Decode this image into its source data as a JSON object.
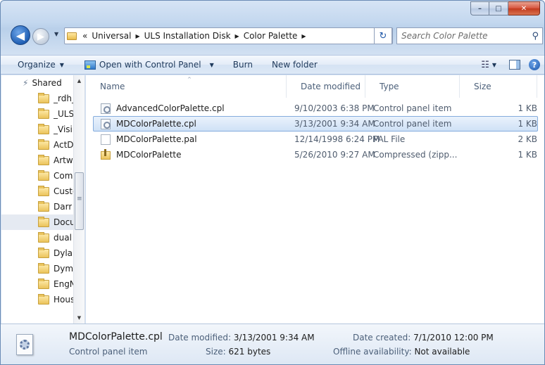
{
  "window": {
    "caption_buttons": {
      "minimize": "–",
      "maximize": "□",
      "close": "✕"
    }
  },
  "nav": {
    "back_glyph": "◀",
    "forward_glyph": "▶",
    "history_glyph": "▼"
  },
  "address": {
    "overflow": "«",
    "crumbs": [
      "Universal",
      "ULS Installation Disk",
      "Color Palette"
    ],
    "separator": "▶",
    "dropdown_glyph": "▼",
    "refresh_glyph": "↻"
  },
  "search": {
    "placeholder": "Search Color Palette",
    "icon": "search-icon"
  },
  "toolbar": {
    "organize": "Organize",
    "open_with": "Open with Control Panel",
    "burn": "Burn",
    "new_folder": "New folder",
    "arrow": "▼",
    "views_glyph": "☷",
    "help_glyph": "?"
  },
  "nav_pane": {
    "items": [
      "Shared",
      "_rdh_",
      "_ULS",
      "_Visi",
      "ActD",
      "Artw",
      "Com",
      "Custo",
      "Darr",
      "Docu",
      "dual",
      "Dyla",
      "Dym",
      "EngN",
      "Hous"
    ],
    "scroll_up": "▲",
    "scroll_down": "▼"
  },
  "columns": {
    "name": "Name",
    "date": "Date modified",
    "type": "Type",
    "size": "Size",
    "sort_glyph": "^"
  },
  "files": [
    {
      "name": "AdvancedColorPalette.cpl",
      "date": "9/10/2003 6:38 PM",
      "type": "Control panel item",
      "size": "1 KB",
      "icon": "control-panel-icon"
    },
    {
      "name": "MDColorPalette.cpl",
      "date": "3/13/2001 9:34 AM",
      "type": "Control panel item",
      "size": "1 KB",
      "icon": "control-panel-icon"
    },
    {
      "name": "MDColorPalette.pal",
      "date": "12/14/1998 6:24 PM",
      "type": "PAL File",
      "size": "2 KB",
      "icon": "document-icon"
    },
    {
      "name": "MDColorPalette",
      "date": "5/26/2010 9:27 AM",
      "type": "Compressed (zipp...",
      "size": "1 KB",
      "icon": "zip-folder-icon"
    }
  ],
  "details": {
    "name": "MDColorPalette.cpl",
    "type": "Control panel item",
    "modified_label": "Date modified:",
    "modified_value": "3/13/2001 9:34 AM",
    "size_label": "Size:",
    "size_value": "621 bytes",
    "created_label": "Date created:",
    "created_value": "7/1/2010 12:00 PM",
    "offline_label": "Offline availability:",
    "offline_value": "Not available"
  },
  "colors": {
    "selection_fill": "#cfe1f6",
    "selection_border": "#84acdd",
    "toolbar_text": "#1e395b"
  }
}
